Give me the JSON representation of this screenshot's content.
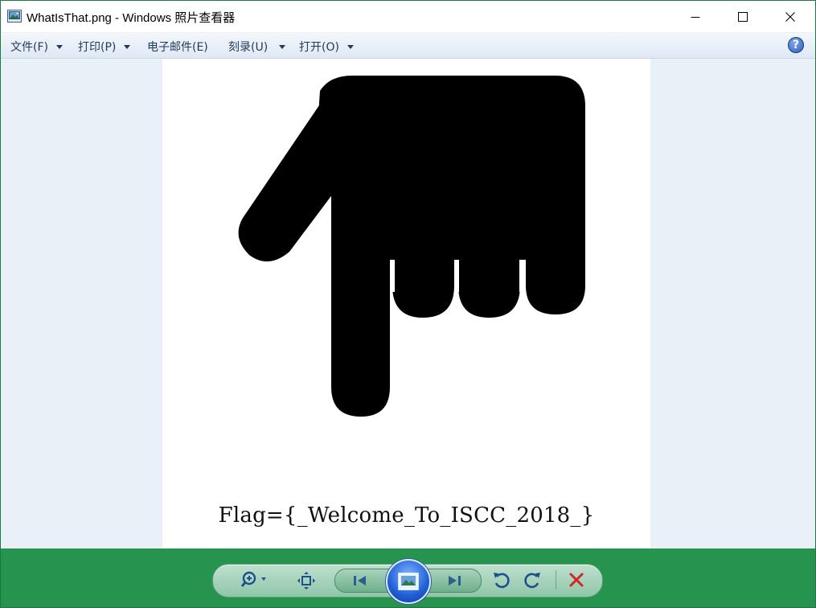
{
  "window": {
    "title": "WhatIsThat.png - Windows 照片查看器"
  },
  "menu": {
    "items": [
      {
        "label": "文件(F)",
        "has_dropdown": true
      },
      {
        "label": "打印(P)",
        "has_dropdown": true
      },
      {
        "label": "电子邮件(E)",
        "has_dropdown": false
      },
      {
        "label": "刻录(U)",
        "has_dropdown": true
      },
      {
        "label": "打开(O)",
        "has_dropdown": true
      }
    ],
    "help_label": "?"
  },
  "image": {
    "caption": "Flag={_Welcome_To_ISCC_2018_}",
    "icon": "pointing-down-hand-icon"
  },
  "controls": {
    "icons": [
      "zoom-icon",
      "fit-to-window-icon",
      "previous-icon",
      "slideshow-icon",
      "next-icon",
      "rotate-counterclockwise-icon",
      "rotate-clockwise-icon",
      "delete-icon"
    ]
  },
  "colors": {
    "control_bar": "#26934e",
    "viewer_background": "#eaf0f8",
    "delete_icon": "#d0262b"
  }
}
